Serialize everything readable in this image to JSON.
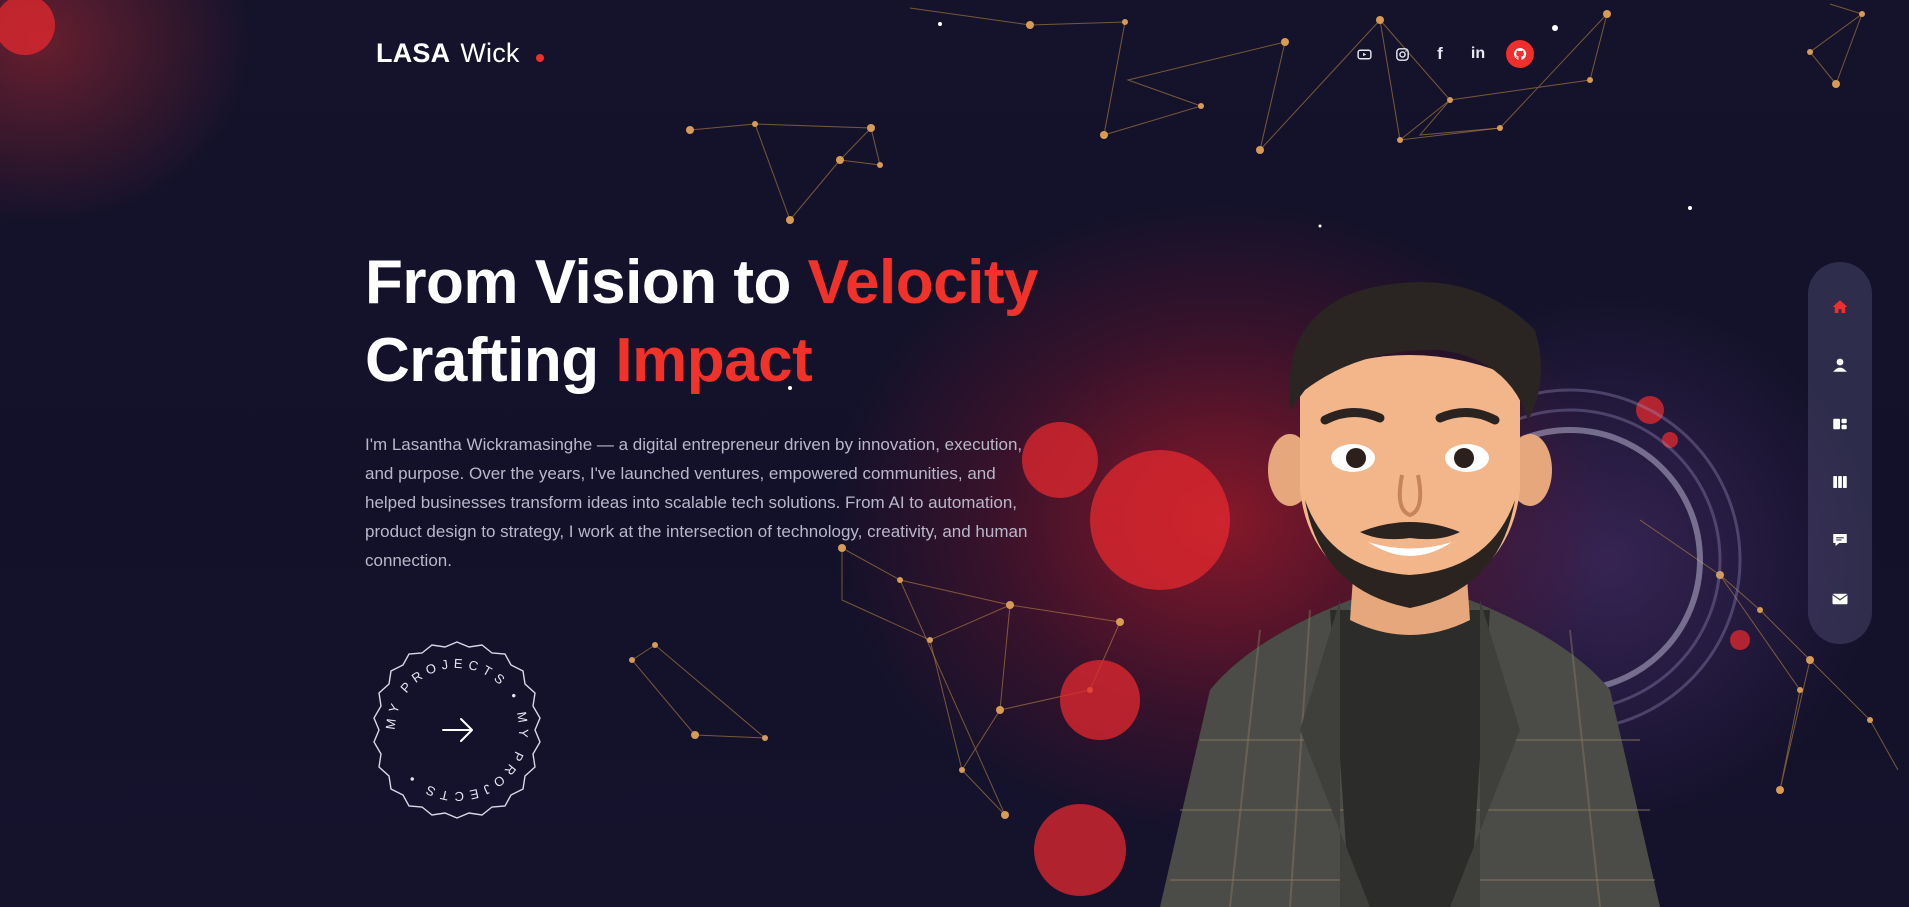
{
  "header": {
    "logo_bold": "LASA",
    "logo_light": "Wick"
  },
  "social": {
    "icons": [
      "youtube-icon",
      "instagram-icon",
      "facebook-icon",
      "linkedin-icon",
      "github-icon"
    ],
    "linkedin_text": "in",
    "facebook_text": "f"
  },
  "hero": {
    "line1_white": "From Vision to ",
    "line1_accent": "Velocity",
    "line2_white": "Crafting ",
    "line2_accent": "Impact",
    "intro": "I'm Lasantha Wickramasinghe — a digital entrepreneur driven by innovation, execution, and purpose. Over the years, I've launched ventures, empowered communities, and helped businesses transform ideas into scalable tech solutions. From AI to automation, product design to strategy, I work at the intersection of technology, creativity, and human connection."
  },
  "cta": {
    "ring_text": "MY PROJECTS • MY PROJECTS •"
  },
  "sidenav": {
    "items": [
      "home-icon",
      "user-icon",
      "services-icon",
      "portfolio-icon",
      "chat-icon",
      "mail-icon"
    ],
    "active": "home-icon"
  },
  "colors": {
    "accent": "#ef2f2b",
    "background": "#14122a",
    "text_muted": "#b9b7c9",
    "nav_bg": "#4a4665"
  }
}
